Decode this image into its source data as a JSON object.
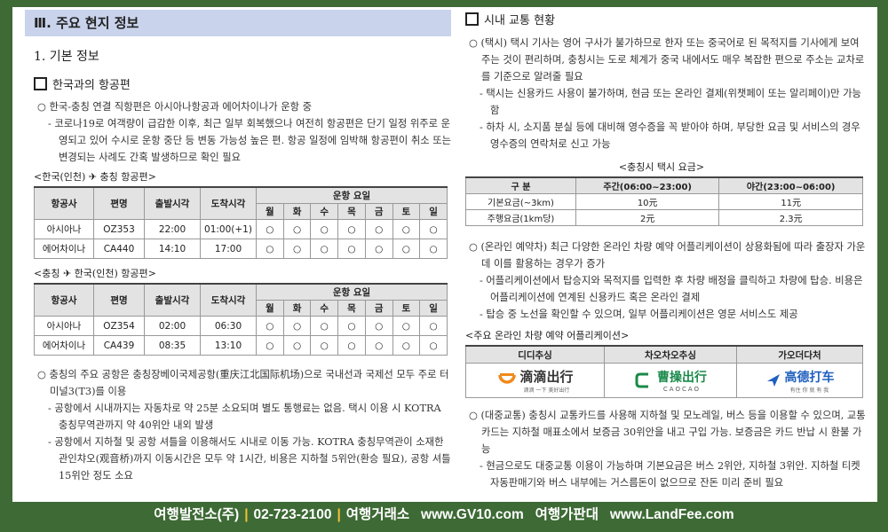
{
  "left": {
    "section_title": "Ⅲ. 주요 현지 정보",
    "heading1": "1. 기본 정보",
    "box1": "한국과의 항공편",
    "p1": [
      "○ 한국-충칭 연결 직항편은 아시아나항공과 에어차이나가 운항 중",
      "- 코로나19로 여객량이 급감한 이후, 최근 일부 회복했으나 여전히 항공편은 단기 일정 위주로 운영되고 있어 수시로 운항 중단 등 변동 가능성 높은 편. 항공 일정에 임박해 항공편이 취소 또는 변경되는 사례도 간혹 발생하므로 확인 필요"
    ],
    "table_headers": {
      "airline": "항공사",
      "flight": "편명",
      "dep": "출발시각",
      "arr": "도착시각",
      "days_title": "운항 요일",
      "days": [
        "월",
        "화",
        "수",
        "목",
        "금",
        "토",
        "일"
      ]
    },
    "mark": "○",
    "table1": {
      "caption": "<한국(인천) ✈ 충칭 항공편>",
      "rows": [
        {
          "airline": "아시아나",
          "flight": "OZ353",
          "dep": "22:00",
          "arr": "01:00(+1)"
        },
        {
          "airline": "에어차이나",
          "flight": "CA440",
          "dep": "14:10",
          "arr": "17:00"
        }
      ]
    },
    "table2": {
      "caption": "<충칭 ✈ 한국(인천) 항공편>",
      "rows": [
        {
          "airline": "아시아나",
          "flight": "OZ354",
          "dep": "02:00",
          "arr": "06:30"
        },
        {
          "airline": "에어차이나",
          "flight": "CA439",
          "dep": "08:35",
          "arr": "13:10"
        }
      ]
    },
    "p2": [
      "○ 충칭의 주요 공항은 충칭장베이국제공항(重庆江北国际机场)으로 국내선과 국제선 모두 주로 터미널3(T3)를 이용",
      "- 공항에서 시내까지는 자동차로 약 25분 소요되며 별도 통행료는 없음. 택시 이용 시 KOTRA 충칭무역관까지 약 40위안 내외 발생",
      "- 공항에서 지하철 및 공항 셔틀을 이용해서도 시내로 이동 가능. KOTRA 충칭무역관이 소재한 관인챠오(观音桥)까지 이동시간은 모두 약 1시간, 비용은 지하철 5위안(환승 필요), 공항 셔틀 15위안 정도 소요"
    ]
  },
  "right": {
    "box1": "시내 교통 현황",
    "p1": [
      "○ (택시) 택시 기사는 영어 구사가 불가하므로 한자 또는 중국어로 된 목적지를 기사에게 보여주는 것이 편리하며, 충칭시는 도로 체계가 중국 내에서도 매우 복잡한 편으로 주소는 교차로를 기준으로 알려줄 필요",
      "- 택시는 신용카드 사용이 불가하며, 현금 또는 온라인 결제(위챗페이 또는 알리페이)만 가능함",
      "- 하차 시, 소지품 분실 등에 대비해 영수증을 꼭 받아야 하며, 부당한 요금 및 서비스의 경우 영수증의 연락처로 신고 가능"
    ],
    "taxi": {
      "caption": "<충칭시 택시 요금>",
      "headers": [
        "구  분",
        "주간(06:00~23:00)",
        "야간(23:00~06:00)"
      ],
      "rows": [
        [
          "기본요금(~3km)",
          "10元",
          "11元"
        ],
        [
          "주행요금(1km당)",
          "2元",
          "2.3元"
        ]
      ]
    },
    "p2": [
      "○ (온라인 예약차) 최근 다양한 온라인 차량 예약 어플리케이션이 상용화됨에 따라 출장자 가운데 이를 활용하는 경우가 증가",
      "- 어플리케이션에서 탑승지와 목적지를 입력한 후 차량 배정을 클릭하고 차량에 탑승. 비용은 어플리케이션에 연계된 신용카드 혹은 온라인 결제",
      "- 탑승 중 노선을 확인할 수 있으며, 일부 어플리케이션은 영문 서비스도 제공"
    ],
    "apps": {
      "caption": "<주요 온라인 차량 예약 어플리케이션>",
      "headers": [
        "디디추싱",
        "차오차오추싱",
        "가오더다처"
      ],
      "logos": [
        {
          "main": "滴滴出行",
          "sub": "滴滴 一下 美好出行",
          "color": "#f08a1c"
        },
        {
          "main": "曹操出行",
          "sub": "CAOCAO",
          "color": "#1a8a4a"
        },
        {
          "main": "高德打车",
          "sub": "有住 你 就 有 我",
          "color": "#1f5fbf"
        }
      ]
    },
    "p3": [
      "○ (대중교통) 충칭시 교통카드를 사용해 지하철 및 모노레일, 버스 등을 이용할 수 있으며, 교통카드는 지하철 매표소에서 보증금 30위안을 내고 구입 가능. 보증금은 카드 반납 시 환불 가능",
      "- 현금으로도 대중교통 이용이 가능하며 기본요금은 버스 2위안, 지하철 3위안. 지하철 티켓 자동판매기와 버스 내부에는 거스름돈이 없으므로 잔돈 미리 준비 필요"
    ]
  },
  "footer": {
    "items": [
      "여행발전소(주)",
      "02-723-2100",
      "여행거래소   www.GV10.com   여행가판대   www.LandFee.com"
    ],
    "separator": "|"
  }
}
